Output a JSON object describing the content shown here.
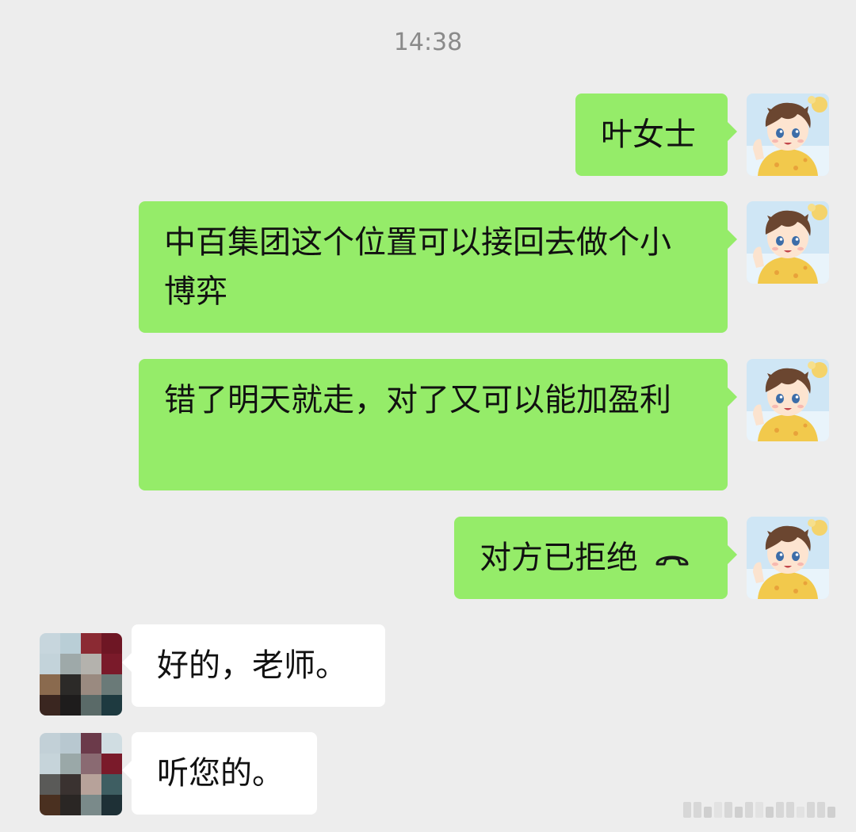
{
  "chat": {
    "timestamp": "14:38",
    "messages": [
      {
        "side": "sent",
        "text": "叶女士"
      },
      {
        "side": "sent",
        "text": "中百集团这个位置可以接回去做个小博弈"
      },
      {
        "side": "sent",
        "text": "错了明天就走，对了又可以能加盈利"
      },
      {
        "side": "sent",
        "text": "对方已拒绝",
        "icon": "phone-hangup-icon"
      },
      {
        "side": "received",
        "text": "好的，老师。"
      },
      {
        "side": "received",
        "text": "听您的。"
      }
    ]
  },
  "colors": {
    "background": "#ededed",
    "sent_bubble": "#95ec69",
    "received_bubble": "#ffffff",
    "timestamp_text": "#8a8a8a"
  }
}
